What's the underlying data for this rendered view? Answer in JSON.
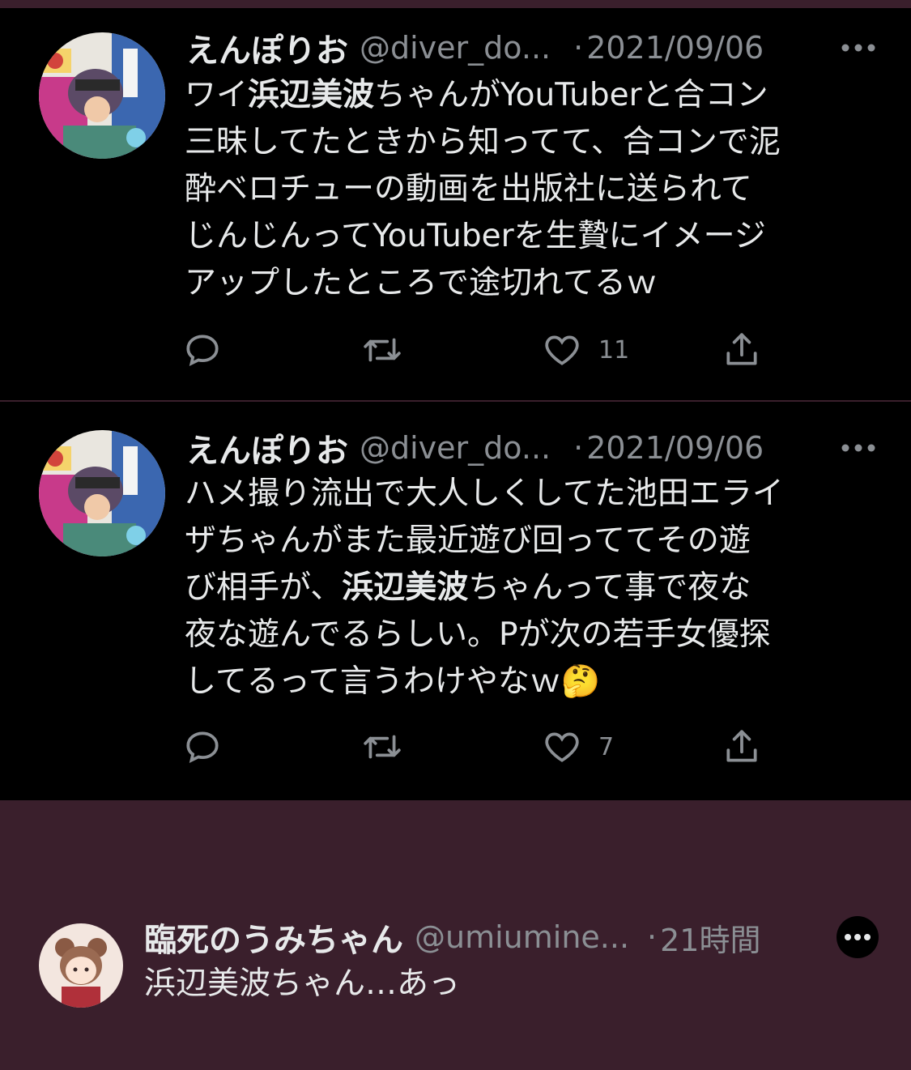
{
  "tweets": [
    {
      "name": "えんぽりお",
      "handle": "@diver_do...",
      "dot": "·",
      "date": "2021/09/06",
      "lines": [
        [
          "ワイ",
          "浜辺美波",
          "ちゃんがYouTuberと合コン"
        ],
        [
          "三昧してたときから知ってて、合コンで泥"
        ],
        [
          "酔ベロチューの動画を出版社に送られて"
        ],
        [
          "じんじんってYouTuberを生贄にイメージ"
        ],
        [
          "アップしたところで途切れてるｗ"
        ]
      ],
      "likes": "11"
    },
    {
      "name": "えんぽりお",
      "handle": "@diver_do...",
      "dot": "·",
      "date": "2021/09/06",
      "lines": [
        [
          "ハメ撮り流出で大人しくしてた池田エライ"
        ],
        [
          "ザちゃんがまた最近遊び回っててその遊"
        ],
        [
          "び相手が、",
          "浜辺美波",
          "ちゃんって事で夜な"
        ],
        [
          "夜な遊んでるらしい。Pが次の若手女優探"
        ],
        [
          "してるって言うわけやなｗ🤔"
        ]
      ],
      "likes": "7"
    }
  ],
  "reply": {
    "name": "臨死のうみちゃん",
    "handle": "@umiumine...",
    "dot": "·",
    "time": "21時間",
    "text": "浜辺美波ちゃん…あっ"
  },
  "icons": {
    "more": "more-horizontal-icon",
    "reply": "reply-icon",
    "retweet": "retweet-icon",
    "like": "heart-icon",
    "share": "share-icon"
  },
  "colors": {
    "background": "#3a1f2c",
    "card": "#000000",
    "text": "#e7e9ea",
    "secondary": "#8b8f94"
  }
}
